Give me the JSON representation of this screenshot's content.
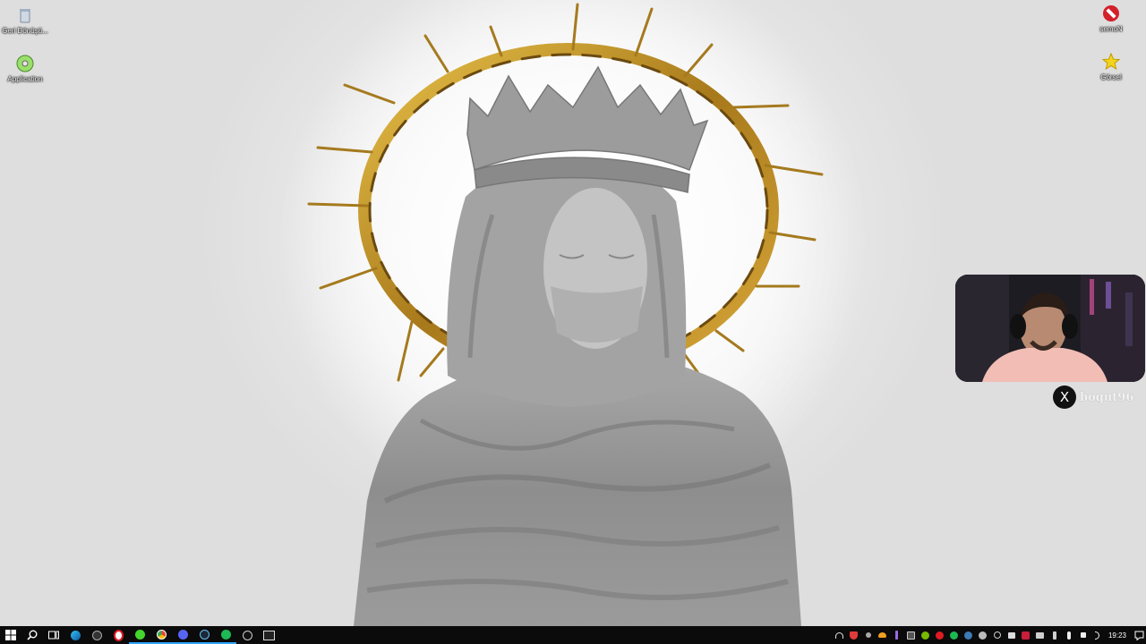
{
  "desktop": {
    "icons_left": [
      {
        "name": "recycle-bin",
        "label": "Geri Dönüşü...",
        "icon": "recycle-bin-icon"
      },
      {
        "name": "application",
        "label": "Application",
        "icon": "cd-icon"
      }
    ],
    "icons_right": [
      {
        "name": "nomes",
        "label": "semoN",
        "icon": "no-entry-icon"
      },
      {
        "name": "gorsel",
        "label": "Görsel",
        "icon": "star-icon"
      }
    ]
  },
  "webcam": {
    "twitter_handle": "boqut96",
    "x_logo": "X"
  },
  "taskbar": {
    "apps": [
      "start",
      "search",
      "task-view",
      "edge",
      "obs",
      "opera",
      "razer",
      "chrome",
      "discord",
      "steam",
      "spotify",
      "chatgpt",
      "terminal"
    ],
    "tray_icons": [
      "headset",
      "vpn",
      "arrow",
      "cloud",
      "pen",
      "cpu",
      "nvidia",
      "record",
      "spotify",
      "steam",
      "settings",
      "wifi",
      "network",
      "game",
      "display",
      "usb",
      "mic",
      "speaker",
      "volume"
    ],
    "time": "19:23",
    "colors": {
      "accent": "#2ea6ff",
      "spotify": "#1db954",
      "razer": "#44d62c",
      "opera": "#e01b23",
      "discord": "#5865f2"
    }
  }
}
